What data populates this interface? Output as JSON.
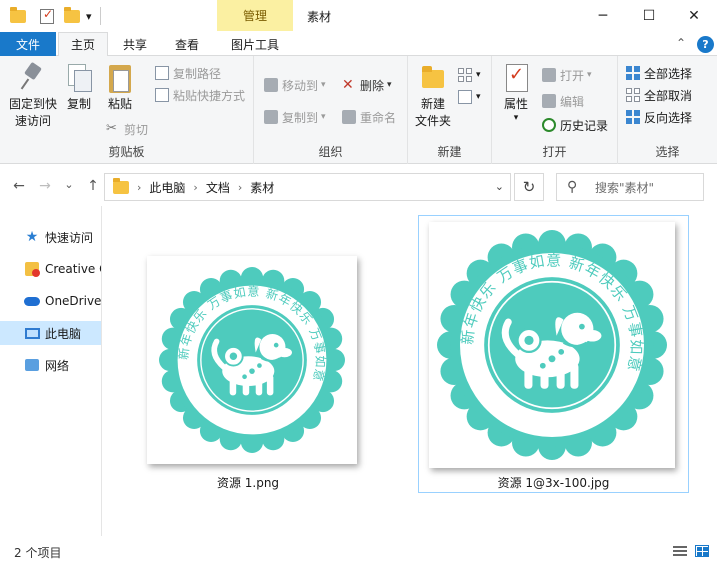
{
  "window": {
    "title": "素材",
    "manage_tab": "管理",
    "controls": {
      "minimize": "─",
      "maximize": "☐",
      "close": "✕"
    },
    "qat_dropdown": "▾"
  },
  "tabs": {
    "file": "文件",
    "home": "主页",
    "share": "共享",
    "view": "查看",
    "picture_tools": "图片工具",
    "collapse": "⌃",
    "help": "?"
  },
  "ribbon": {
    "clipboard": {
      "label": "剪贴板",
      "pin": "固定到快\n速访问",
      "copy": "复制",
      "paste": "粘贴",
      "copy_path": "复制路径",
      "paste_shortcut": "粘贴快捷方式",
      "cut": "剪切"
    },
    "organize": {
      "label": "组织",
      "move_to": "移动到",
      "copy_to": "复制到",
      "delete": "删除",
      "rename": "重命名",
      "dropdown": "▾"
    },
    "new": {
      "label": "新建",
      "new_folder": "新建\n文件夹"
    },
    "open": {
      "label": "打开",
      "properties": "属性",
      "open": "打开",
      "edit": "编辑",
      "history": "历史记录",
      "dropdown": "▾"
    },
    "select": {
      "label": "选择",
      "select_all": "全部选择",
      "select_none": "全部取消",
      "invert": "反向选择"
    }
  },
  "address": {
    "back": "←",
    "forward": "→",
    "recent": "⌄",
    "up": "↑",
    "sep": "›",
    "crumbs": [
      "此电脑",
      "文档",
      "素材"
    ],
    "dropdown": "⌄",
    "refresh": "↻",
    "search_placeholder": "搜索\"素材\""
  },
  "nav": {
    "items": [
      {
        "label": "快速访问",
        "icon": "star-icon"
      },
      {
        "label": "Creative Cloud Files",
        "icon": "creative-cloud-icon"
      },
      {
        "label": "OneDrive",
        "icon": "onedrive-icon"
      },
      {
        "label": "此电脑",
        "icon": "this-pc-icon"
      },
      {
        "label": "网络",
        "icon": "network-icon"
      }
    ]
  },
  "files": [
    {
      "name": "资源 1.png"
    },
    {
      "name": "资源 1@3x-100.jpg"
    }
  ],
  "stamp": {
    "text": "新年快乐  万事如意  新年快乐  万事如意  ",
    "color": "#4ecbbd",
    "inner_color": "#ffffff"
  },
  "status": {
    "item_count": "2 个项目"
  },
  "colors": {
    "accent": "#1979ca",
    "manage": "#fbf0a2",
    "selection": "#cce8ff"
  }
}
